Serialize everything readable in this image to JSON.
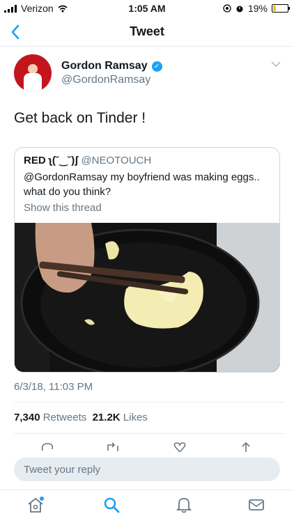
{
  "status_bar": {
    "carrier": "Verizon",
    "time": "1:05 AM",
    "battery": "19%",
    "battery_level": 0.19
  },
  "nav": {
    "title": "Tweet"
  },
  "tweet": {
    "author_name": "Gordon Ramsay",
    "author_handle": "@GordonRamsay",
    "text": "Get back on Tinder !",
    "quoted": {
      "author_name": "RED ʅ(˘‿˘)ʃ",
      "author_handle": "@NEOTOUCH",
      "text": "@GordonRamsay my boyfriend was making eggs.. what do you think?",
      "thread_link": "Show this thread"
    },
    "timestamp": "6/3/18, 11:03 PM",
    "retweets_count": "7,340",
    "retweets_label": "Retweets",
    "likes_count": "21.2K",
    "likes_label": "Likes"
  },
  "reply": {
    "placeholder": "Tweet your reply"
  },
  "colors": {
    "accent": "#1da1f2",
    "muted": "#657786"
  },
  "icons": {
    "back": "chevron-left-icon",
    "verified": "verified-badge-icon",
    "caret": "chevron-down-icon",
    "reply": "reply-icon",
    "retweet": "retweet-icon",
    "like": "heart-icon",
    "share": "share-icon",
    "home": "home-icon",
    "search": "search-icon",
    "notifications": "bell-icon",
    "messages": "mail-icon"
  }
}
